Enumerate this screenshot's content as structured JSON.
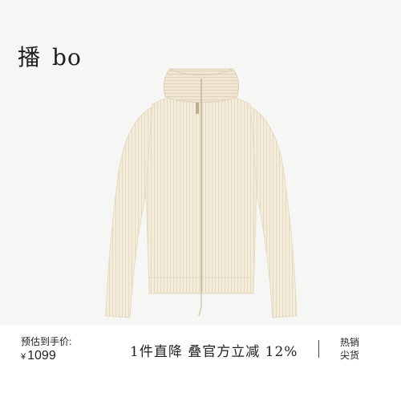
{
  "brand": {
    "part1": "播",
    "part2": "bo"
  },
  "product": {
    "image_icon": "zip-cardigan-sweater-illustration",
    "color": "#f3ecda"
  },
  "price": {
    "label": "预估到手价:",
    "currency": "¥",
    "value": "1099"
  },
  "promo": {
    "text": "1件直降 叠官方立减 12%"
  },
  "badge": {
    "line1": "热销",
    "line2": "尖货"
  }
}
